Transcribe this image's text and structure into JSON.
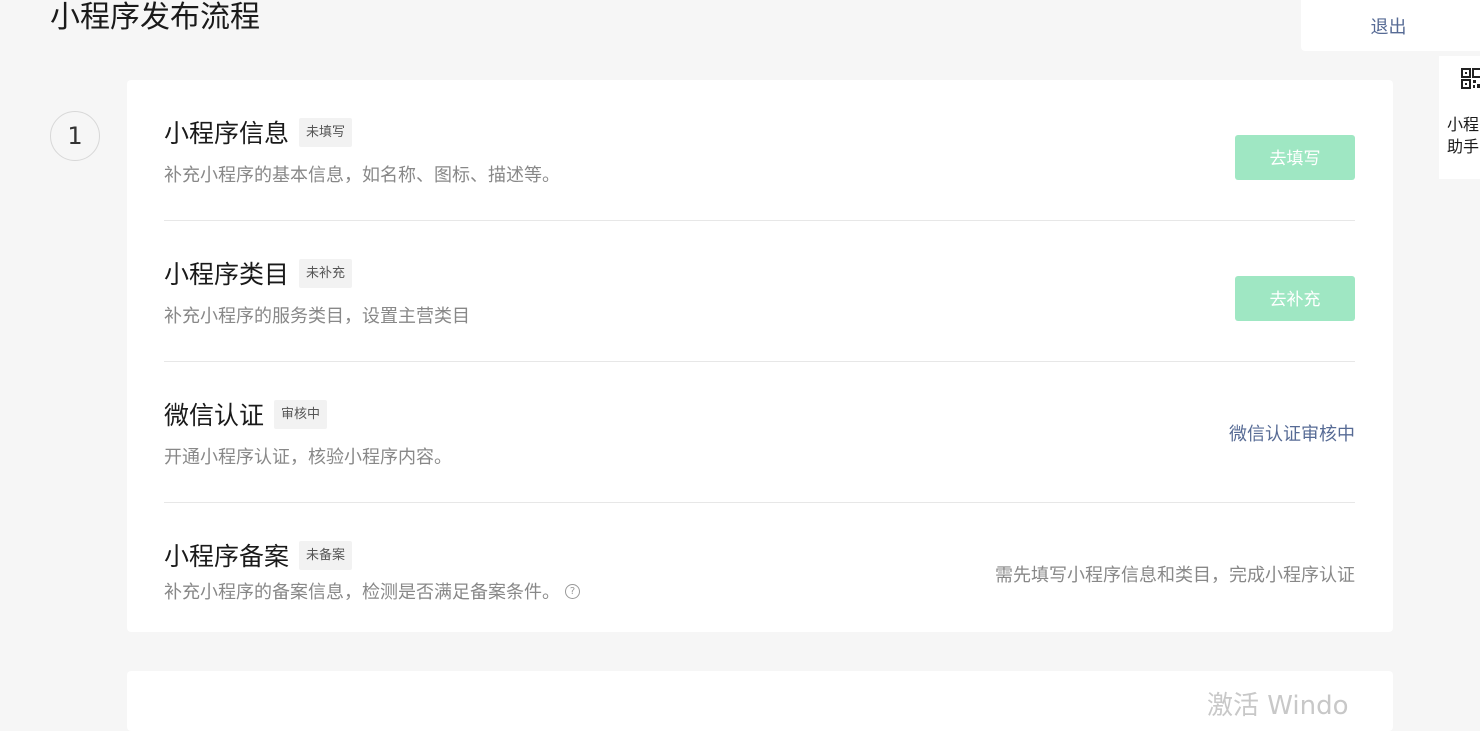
{
  "page": {
    "title": "小程序发布流程",
    "logout_label": "退出",
    "helper_label": "小程\n助手"
  },
  "step": {
    "number": "1"
  },
  "rows": [
    {
      "title": "小程序信息",
      "tag": "未填写",
      "desc": "补充小程序的基本信息，如名称、图标、描述等。",
      "action": "去填写"
    },
    {
      "title": "小程序类目",
      "tag": "未补充",
      "desc": "补充小程序的服务类目，设置主营类目",
      "action": "去补充"
    },
    {
      "title": "微信认证",
      "tag": "审核中",
      "desc": "开通小程序认证，核验小程序内容。",
      "action": "微信认证审核中"
    },
    {
      "title": "小程序备案",
      "tag": "未备案",
      "desc": "补充小程序的备案信息，检测是否满足备案条件。",
      "action": "需先填写小程序信息和类目，完成小程序认证"
    }
  ],
  "watermark": "激活 Windo",
  "icons": {
    "qr": "qr-code-icon",
    "help": "help-circle-icon"
  },
  "colors": {
    "accent_green_disabled": "#9fe7c3",
    "link_blue": "#576b95"
  }
}
